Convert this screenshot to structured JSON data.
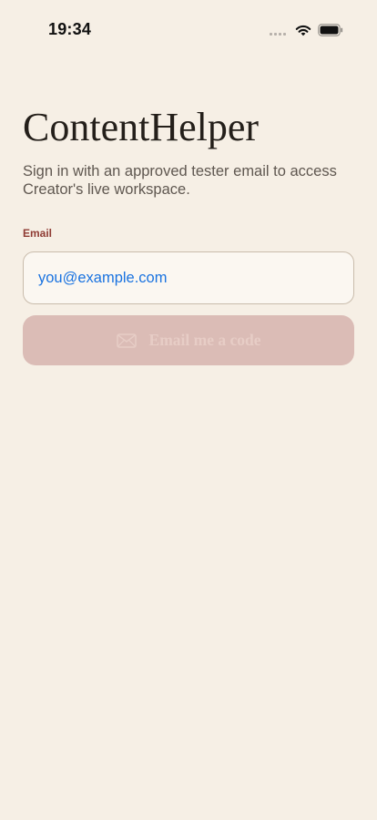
{
  "status_bar": {
    "time": "19:34",
    "icons": [
      "cellular-signal-icon",
      "wifi-icon",
      "battery-icon"
    ]
  },
  "app": {
    "title": "ContentHelper",
    "subtitle": "Sign in with an approved tester email to access Creator's live workspace."
  },
  "form": {
    "email_label": "Email",
    "email_placeholder": "you@example.com",
    "email_value": "",
    "submit_label": "Email me a code",
    "submit_icon": "mail-icon",
    "submit_enabled": false
  },
  "colors": {
    "background": "#f6efe5",
    "label_accent": "#8f3b33",
    "placeholder_blue": "#1a73e0",
    "button_disabled_bg": "#dbbcb6",
    "button_disabled_text": "#e7cdc6"
  }
}
